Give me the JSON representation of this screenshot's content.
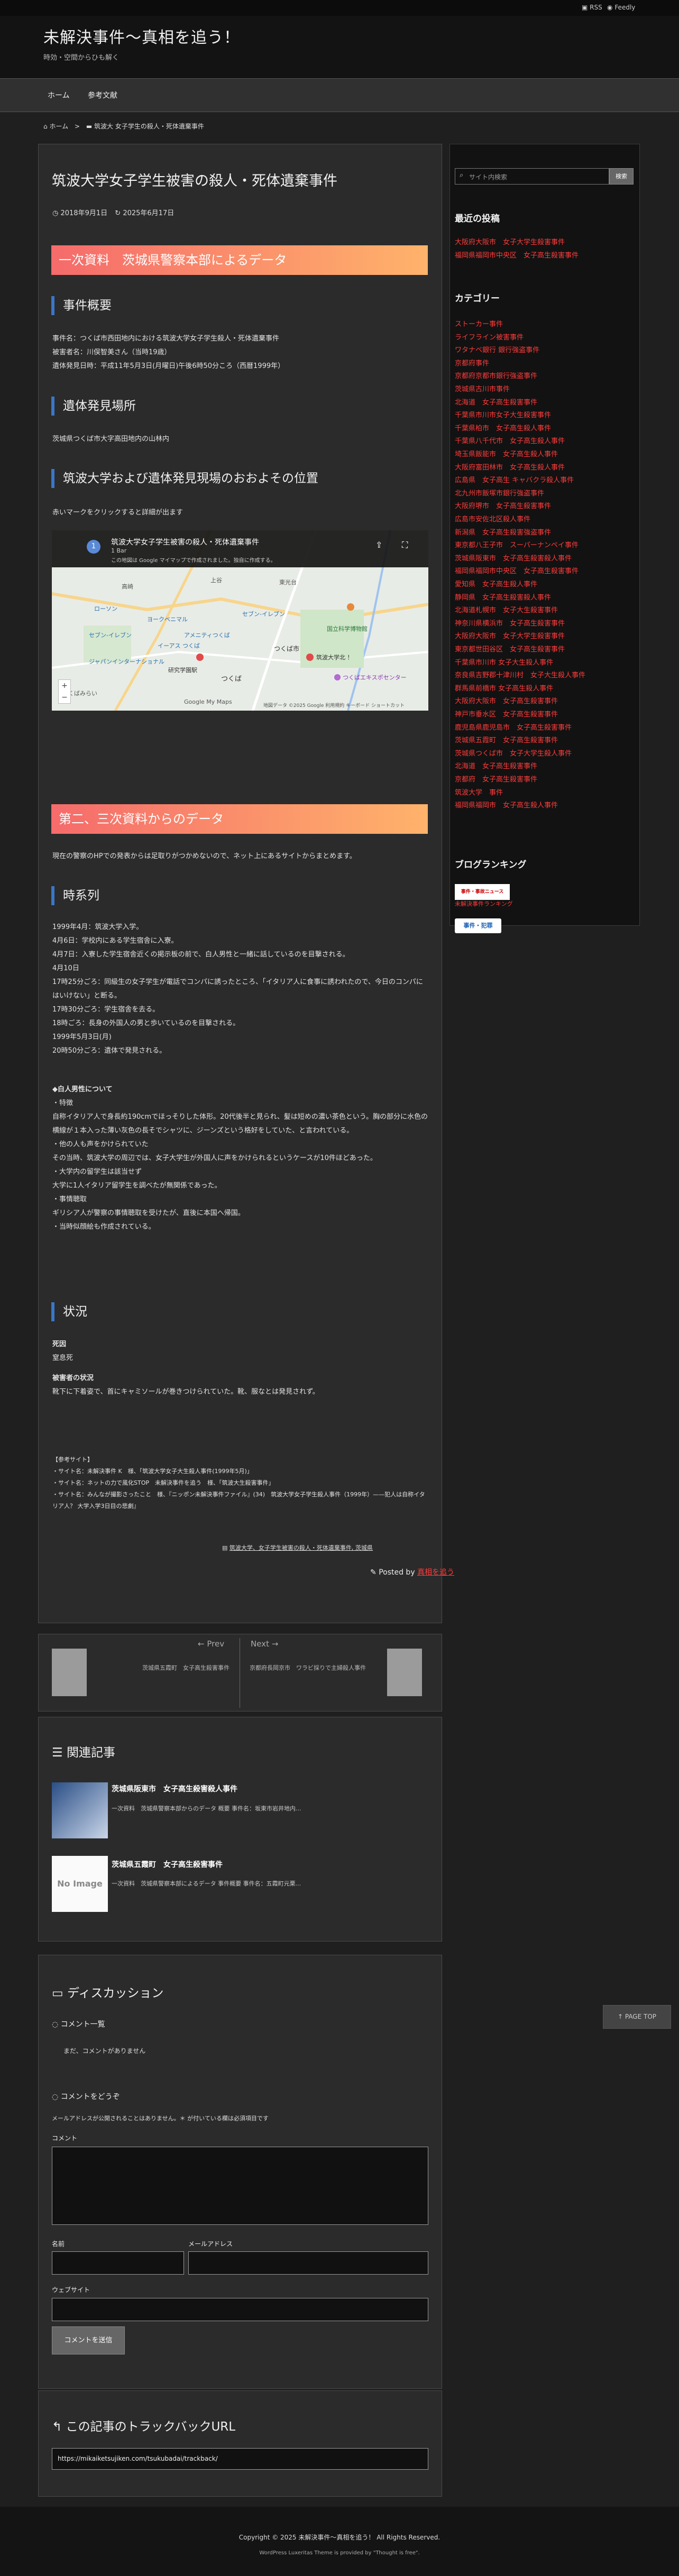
{
  "topbar": {
    "rss": "RSS",
    "feedly": "Feedly"
  },
  "site": {
    "title": "未解決事件〜真相を追う！",
    "description": "時効・空間からひも解く"
  },
  "nav": [
    "ホーム",
    "参考文献"
  ],
  "breadcrumb": {
    "home": "ホーム",
    "category": "筑波大",
    "current": "女子学生の殺人・死体遺棄事件"
  },
  "article": {
    "title": "筑波大学女子学生被害の殺人・死体遺棄事件",
    "date_published": "2018年9月1日",
    "date_updated": "2025年6月17日",
    "section1": "一次資料　茨城県警察本部によるデータ",
    "h_outline": "事件概要",
    "outline_lines": [
      "事件名：つくば市西田地内における筑波大学女子学生殺人・死体遺棄事件",
      "被害者名：川俣智美さん（当時19歳）",
      "遺体発見日時：平成11年5月3日(月曜日)午後6時50分ころ（西暦1999年）"
    ],
    "h_place": "遺体発見場所",
    "place_text": "茨城県つくば市大字高田地内の山林内",
    "h_map": "筑波大学および遺体発見現場のおおよその位置",
    "map_text": "赤いマークをクリックすると詳細が出ます",
    "map": {
      "number": "1",
      "title": "筑波大学女子学生被害の殺人・死体遺棄事件",
      "views": "1 Bar",
      "note": "この地図は Google マイマップで作成されました。独自に作成する。",
      "place_labels": [
        "高崎",
        "上谷",
        "つくばみらい",
        "筑波大学北 ！",
        "つくば市",
        "研究学園駅",
        "つくば",
        "東光台",
        "ローソン",
        "セブン-イレブン",
        "ヨークベニマル",
        "イーアス つくば",
        "アメニティつくば",
        "国立科学博物館",
        "セブン-イレブン",
        "つくばエキスポセンター",
        "ジャパンインターナショナル",
        "Google My Maps"
      ],
      "footer": "地図データ ©2025 Google  利用規約  キーボード ショートカット"
    },
    "section2": "第二、三次資料からのデータ",
    "section2_text": "現在の警察のHPでの発表からは足取りがつかめないので、ネット上にあるサイトからまとめます。",
    "h_timeline": "時系列",
    "timeline": [
      "1999年4月：筑波大学入学。",
      "4月6日：学校内にある学生宿舎に入寮。",
      "4月7日：入寮した学生宿舎近くの掲示板の前で、白人男性と一緒に話しているのを目撃される。",
      "4月10日",
      "17時25分ごろ：同級生の女子学生が電話でコンパに誘ったところ、「イタリア人に食事に誘われたので、今日のコンパにはいけない」と断る。",
      "17時30分ごろ：学生宿舎を去る。",
      "18時ごろ：長身の外国人の男と歩いているのを目撃される。",
      "1999年5月3日(月)",
      "20時50分ごろ：遺体で発見される。"
    ],
    "suspect_title": "◆白人男性について",
    "suspect_lines": [
      "・特徴",
      "自称イタリア人で身長約190cmでほっそりした体形。20代後半と見られ、髪は短めの濃い茶色という。胸の部分に水色の横線が１本入った薄い灰色の長そでシャツに、ジーンズという格好をしていた、と言われている。",
      "・他の人も声をかけられていた",
      "その当時、筑波大学の周辺では、女子大学生が外国人に声をかけられるというケースが10件ほどあった。",
      "・大学内の留学生は該当せず",
      "大学に1人イタリア留学生を調べたが無関係であった。",
      "・事情聴取",
      "ギリシア人が警察の事情聴取を受けたが、直後に本国へ帰国。",
      "・当時似顔絵も作成されている。"
    ],
    "h_situation": "状況",
    "cause_title": "死因",
    "cause_text": "窒息死",
    "clothes_title": "被害者の状況",
    "clothes_text": "靴下に下着姿で、首にキャミソールが巻きつけられていた。靴、服なとは発見されず。",
    "refs_title": "【参考サイト】",
    "refs": [
      "・サイト名：未解決事件 K　様、「筑波大学女子大生殺人事件(1999年5月)」",
      "・サイト名：ネットの力で風化STOP　未解決事件を追う　様、「筑波大生殺害事件」",
      "・サイト名：みんなが撮影さったこと　様、『ニッポン未解決事件ファイル』(34)　筑波大学女子学生殺人事件（1999年）——犯人は自称イタリア人？ 大学入学3日目の悲劇』"
    ],
    "tag": "筑波大学、女子学生被害の殺人・死体遺棄事件, 茨城県",
    "posted_by": "Posted by",
    "author": "真相を追う"
  },
  "postnav": {
    "prev_label": "Prev",
    "prev_title": "茨城県五霞町　女子高生殺害事件",
    "next_label": "Next",
    "next_title": "京都府長岡京市　ワラビ採りで主婦殺人事件"
  },
  "related": {
    "title": "関連記事",
    "items": [
      {
        "title": "茨城県阪東市　女子高生殺害殺人事件",
        "excerpt": "一次資料　茨城県警察本部からのデータ 概要 事件名：坂東市岩井地内..."
      },
      {
        "title": "茨城県五霞町　女子高生殺害事件",
        "excerpt": "一次資料　茨城県警察本部によるデータ 事件概要 事件名：五霞町元栗..."
      }
    ],
    "no_image": "No Image"
  },
  "discussion": {
    "title": "ディスカッション",
    "list_title": "コメント一覧",
    "no_comment": "まだ、コメントがありません",
    "form_title": "コメントをどうぞ",
    "notice": "メールアドレスが公開されることはありません。＊ が付いている欄は必須項目です",
    "comment_label": "コメント",
    "name_label": "名前",
    "email_label": "メールアドレス",
    "website_label": "ウェブサイト",
    "submit": "コメントを送信"
  },
  "trackback": {
    "title": "この記事のトラックバックURL",
    "url": "https://mikaiketsujiken.com/tsukubadai/trackback/"
  },
  "sidebar": {
    "search_placeholder": "サイト内検索",
    "search_button": "検索",
    "recent_title": "最近の投稿",
    "recent": [
      "大阪府大阪市　女子大学生殺害事件",
      "福岡県福岡市中央区　女子高生殺害事件"
    ],
    "category_title": "カテゴリー",
    "categories": [
      "ストーカー事件",
      "ライフライン被害事件",
      "ワタナベ銀行 銀行強盗事件",
      "京都府事件",
      "京都府京都市銀行強盗事件",
      "茨城県古川市事件",
      "北海道　女子高生殺害事件",
      "千葉県市川市女子大生殺害事件",
      "千葉県柏市　女子高生殺人事件",
      "千葉県八千代市　女子高生殺人事件",
      "埼玉県飯能市　女子高生殺人事件",
      "大阪府富田林市　女子高生殺人事件",
      "広島県　女子高生 キャバクラ殺人事件",
      "北九州市飯塚市銀行強盗事件",
      "大阪府堺市　女子高生殺害事件",
      "広島市安佐北区殺人事件",
      "新潟県　女子高生殺害強盗事件",
      "東京都八王子市　スーパーナンペイ事件",
      "茨城県阪東市　女子高生殺害殺人事件",
      "福岡県福岡市中央区　女子高生殺害事件",
      "愛知県　女子高生殺人事件",
      "静岡県　女子高生殺害殺人事件",
      "北海道札幌市　女子大生殺害事件",
      "神奈川県横浜市　女子高生殺害事件",
      "大阪府大阪市　女子大学生殺害事件",
      "東京都世田谷区　女子高生殺害事件",
      "千葉県市川市 女子大生殺人事件",
      "奈良県吉野郡十津川村　女子大生殺人事件",
      "群馬県前橋市 女子高生殺人事件",
      "大阪府大阪市　女子高生殺害事件",
      "神戸市垂水区　女子高生殺害事件",
      "鹿児島県鹿児島市　女子高生殺害事件",
      "茨城県五霞町　女子高生殺害事件",
      "茨城県つくば市　女子大学生殺人事件",
      "北海道　女子高生殺害事件",
      "京都府　女子高生殺害事件",
      "筑波大学　事件",
      "福岡県福岡市　女子高生殺人事件"
    ],
    "ranking_title": "ブログランキング",
    "ranking_badge1": "事件・事故ニュース",
    "ranking_link": "未解決事件ランキング",
    "ranking_badge2": "事件・犯罪"
  },
  "pagetop": "PAGE TOP",
  "footer": {
    "copyright": "Copyright © 2025 未解決事件〜真相を追う！ All Rights Reserved.",
    "credit": "WordPress Luxeritas Theme is provided by \"Thought is free\"."
  },
  "colors": {
    "accent_red": "#ff3b3b",
    "heading_bar": "#3a76c7",
    "gradient_start": "#f56b6b",
    "gradient_end": "#ffb36b"
  }
}
